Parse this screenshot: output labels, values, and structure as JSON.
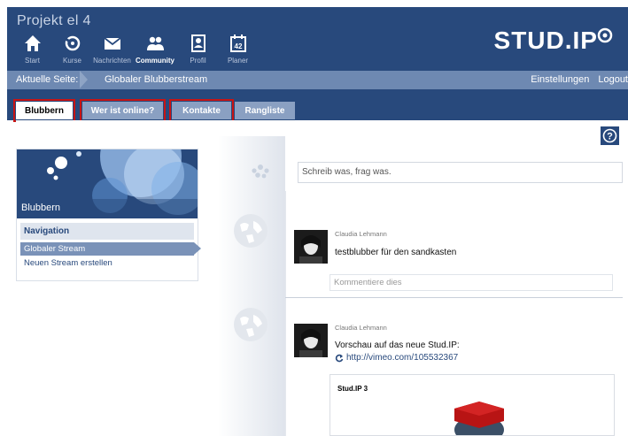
{
  "header": {
    "title": "Projekt el 4",
    "logo": "STUD.IP",
    "nav": [
      {
        "label": "Start",
        "icon": "home-icon"
      },
      {
        "label": "Kurse",
        "icon": "courses-icon"
      },
      {
        "label": "Nachrichten",
        "icon": "mail-icon"
      },
      {
        "label": "Community",
        "icon": "community-icon",
        "active": true
      },
      {
        "label": "Profil",
        "icon": "profile-icon"
      },
      {
        "label": "Planer",
        "icon": "calendar-icon",
        "badge": "42"
      }
    ]
  },
  "breadcrumb": {
    "label": "Aktuelle Seite:",
    "current": "Globaler Blubberstream",
    "links": [
      "Einstellungen",
      "Logout"
    ]
  },
  "tabs": [
    {
      "label": "Blubbern",
      "active": true,
      "highlighted": true
    },
    {
      "label": "Wer ist online?",
      "highlighted": true
    },
    {
      "label": "Kontakte",
      "highlighted": true
    },
    {
      "label": "Rangliste",
      "highlighted": false
    }
  ],
  "sidebar": {
    "title": "Blubbern",
    "nav_title": "Navigation",
    "items": [
      "Globaler Stream",
      "Neuen Stream erstellen"
    ]
  },
  "compose": {
    "placeholder": "Schreib was, frag was."
  },
  "posts": [
    {
      "author": "Claudia Lehmann",
      "text": "testblubber für den sandkasten",
      "comment_placeholder": "Kommentiere dies"
    },
    {
      "author": "Claudia Lehmann",
      "text": "Vorschau auf das neue Stud.IP:",
      "link": "http://vimeo.com/105532367",
      "preview_title": "Stud.IP 3"
    }
  ],
  "colors": {
    "header": "#28497c",
    "breadcrumb": "#6e89b2",
    "tab": "#8aa0c2",
    "highlight": "#c81414"
  }
}
